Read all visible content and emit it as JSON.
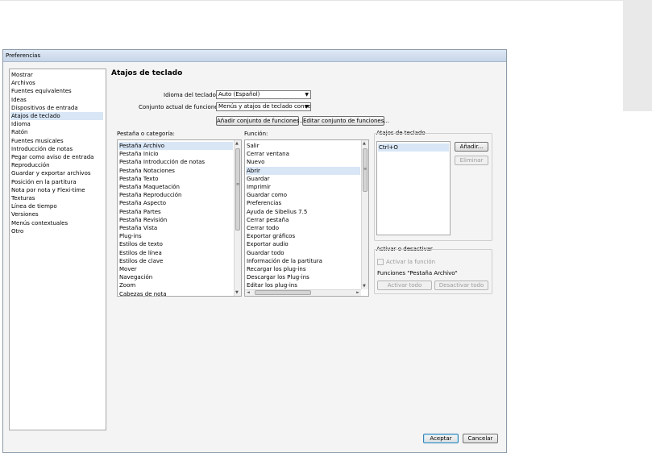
{
  "window": {
    "title": "Preferencias"
  },
  "categories": [
    "Mostrar",
    "Archivos",
    "Fuentes equivalentes",
    "Ideas",
    "Dispositivos de entrada",
    "Atajos de teclado",
    "Idioma",
    "Ratón",
    "Fuentes musicales",
    "Introducción de notas",
    "Pegar como aviso de entrada",
    "Reproducción",
    "Guardar y exportar archivos",
    "Posición en la partitura",
    "Nota por nota y Flexi-time",
    "Texturas",
    "Línea de tiempo",
    "Versiones",
    "Menús contextuales",
    "Otro"
  ],
  "selected_category": "Atajos de teclado",
  "heading": "Atajos de teclado",
  "language": {
    "label": "Idioma del teclado:",
    "value": "Auto (Español)"
  },
  "feature_set": {
    "label": "Conjunto actual de funciones:",
    "value": "Menús y atajos de teclado conver"
  },
  "buttons": {
    "add_set": "Añadir conjunto de funciones...",
    "edit_set": "Editar conjunto de funciones...",
    "add_shortcut": "Añadir...",
    "delete_shortcut": "Eliminar",
    "activate_all": "Activar todo",
    "deactivate_all": "Desactivar todo",
    "ok": "Aceptar",
    "cancel": "Cancelar"
  },
  "tab_list": {
    "label": "Pestaña o categoría:",
    "selected": "Pestaña Archivo",
    "items": [
      "Pestaña Archivo",
      "Pestaña Inicio",
      "Pestaña Introducción de notas",
      "Pestaña Notaciones",
      "Pestaña Texto",
      "Pestaña Maquetación",
      "Pestaña Reproducción",
      "Pestaña Aspecto",
      "Pestaña Partes",
      "Pestaña Revisión",
      "Pestaña Vista",
      "Plug-ins",
      "Estilos de texto",
      "Estilos de línea",
      "Estilos de clave",
      "Mover",
      "Navegación",
      "Zoom",
      "Cabezas de nota"
    ]
  },
  "function_list": {
    "label": "Función:",
    "selected": "Abrir",
    "items": [
      "Salir",
      "Cerrar ventana",
      "Nuevo",
      "Abrir",
      "Guardar",
      "Imprimir",
      "Guardar como",
      "Preferencias",
      "Ayuda de Sibelius 7.5",
      "Cerrar pestaña",
      "Cerrar todo",
      "Exportar gráficos",
      "Exportar audio",
      "Guardar todo",
      "Información de la partitura",
      "Recargar los plug-ins",
      "Descargar los Plug-ins",
      "Editar los plug-ins"
    ]
  },
  "shortcuts": {
    "label": "Atajos de teclado",
    "items": [
      "Ctrl+O"
    ]
  },
  "activation": {
    "label": "Activar o desactivar",
    "checkbox_label": "Activar la función",
    "functions_label": "Funciones \"Pestaña Archivo\""
  },
  "icons": {
    "dropdown": "▼",
    "scroll_up": "▲",
    "scroll_down": "▼",
    "scroll_left": "◄",
    "scroll_right": "►",
    "scroll_grip": "≡"
  }
}
